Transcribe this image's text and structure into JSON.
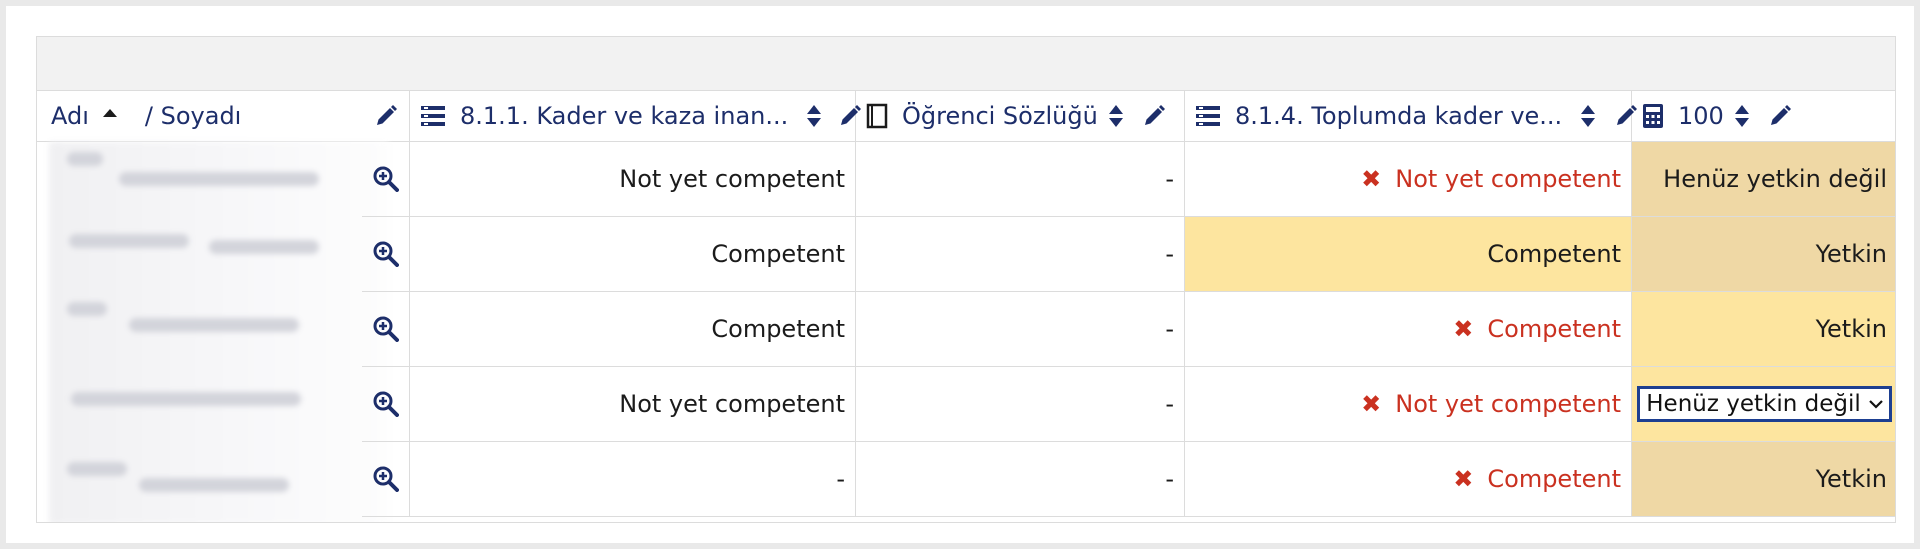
{
  "columns": {
    "name": {
      "first": "Adı",
      "last": "/ Soyadı"
    },
    "c1": {
      "label": "8.1.1. Kader ve kaza inan..."
    },
    "c2": {
      "label": "Öğrenci Sözlüğü"
    },
    "c3": {
      "label": "8.1.4. Toplumda kader ve..."
    },
    "c4": {
      "label": "100"
    }
  },
  "rows": [
    {
      "c1": "Not yet competent",
      "c2": "-",
      "c3": "Not yet competent",
      "c3_fail": true,
      "c4": "Henüz yetkin değil"
    },
    {
      "c1": "Competent",
      "c2": "-",
      "c3": "Competent",
      "c3_fail": false,
      "c4": "Yetkin"
    },
    {
      "c1": "Competent",
      "c2": "-",
      "c3": "Competent",
      "c3_fail": true,
      "c4": "Yetkin"
    },
    {
      "c1": "Not yet competent",
      "c2": "-",
      "c3": "Not yet competent",
      "c3_fail": true,
      "c4": "Henüz yetkin değil"
    },
    {
      "c1": "-",
      "c2": "-",
      "c3": "Competent",
      "c3_fail": true,
      "c4": "Yetkin"
    }
  ],
  "colors": {
    "highlight": "#fde59f",
    "override": "#efd8a5",
    "fail": "#ca3120",
    "header_text": "#1d2e6a"
  }
}
